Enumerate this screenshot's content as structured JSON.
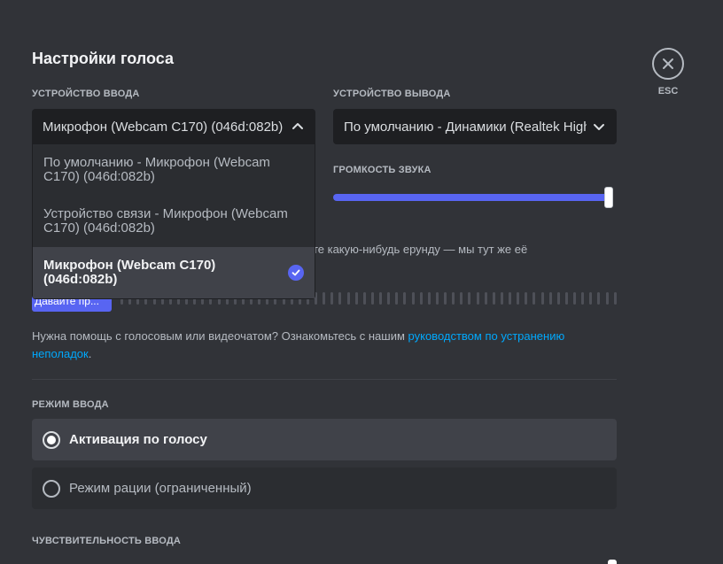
{
  "title": "Настройки голоса",
  "close": {
    "label": "ESC",
    "icon": "close-icon"
  },
  "input_device": {
    "label": "УСТРОЙСТВО ВВОДА",
    "selected": "Микрофон (Webcam C170) (046d:082b)",
    "options": [
      "По умолчанию - Микрофон (Webcam C170) (046d:082b)",
      "Устройство связи - Микрофон (Webcam C170) (046d:082b)",
      "Микрофон (Webcam C170) (046d:082b)"
    ]
  },
  "output_device": {
    "label": "УСТРОЙСТВО ВЫВОДА",
    "selected": "По умолчанию - Динамики (Realtek High Definition Audio)"
  },
  "output_volume": {
    "label": "ГРОМКОСТЬ ЗВУКА",
    "value_fraction": 1.0
  },
  "mic_test": {
    "hint": "ките какую-нибудь ерунду — мы тут же её",
    "button_label": "Давайте пр..."
  },
  "help": {
    "text": "Нужна помощь с голосовым или видеочатом? Ознакомьтесь с нашим ",
    "link": "руководством по устранению неполадок",
    "suffix": "."
  },
  "input_mode": {
    "label": "РЕЖИМ ВВОДА",
    "options": [
      {
        "label": "Активация по голосу",
        "checked": true
      },
      {
        "label": "Режим рации (ограниченный)",
        "checked": false
      }
    ]
  },
  "sensitivity": {
    "label": "ЧУВСТВИТЕЛЬНОСТЬ ВВОДА"
  },
  "colors": {
    "accent": "#5865f2",
    "link": "#00a8fc",
    "background": "#313338"
  }
}
